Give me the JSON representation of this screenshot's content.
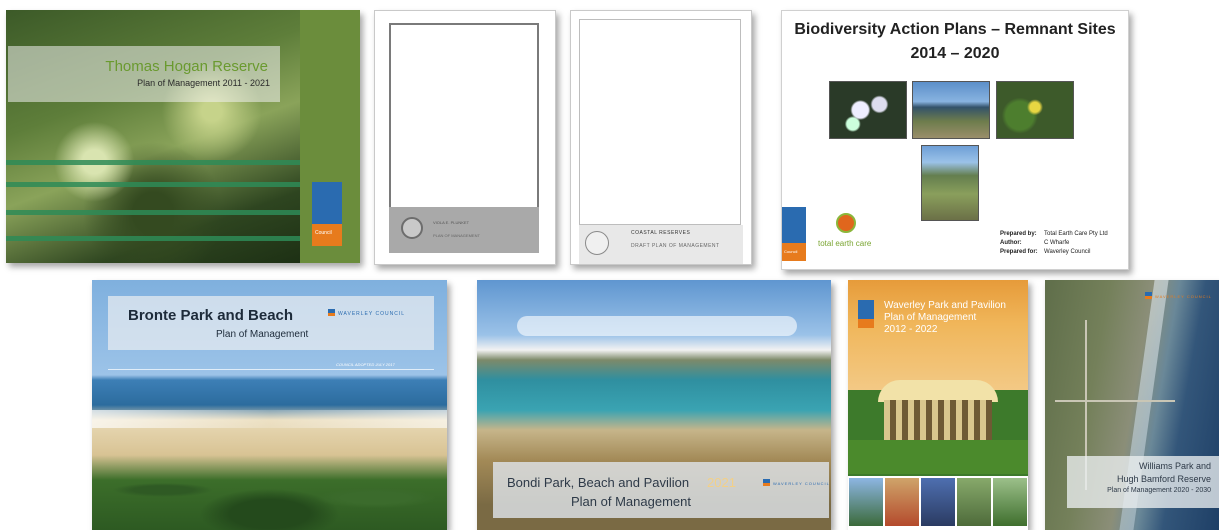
{
  "covers": {
    "thomas_hogan": {
      "title": "Thomas Hogan Reserve",
      "subtitle": "Plan of Management 2011 - 2021",
      "logo_text": "Council"
    },
    "unnamed_cover_1": {
      "line1": "VIOLA E. PLUNKET",
      "line2": "PLAN OF MANAGEMENT"
    },
    "coastal_reserves": {
      "line1": "COASTAL   RESERVES",
      "line2": "DRAFT PLAN OF MANAGEMENT"
    },
    "biodiversity": {
      "title_line1": "Biodiversity Action Plans – Remnant Sites",
      "title_line2": "2014 – 2020",
      "company": "total earth care",
      "logo_text": "Council",
      "prepared_by_label": "Prepared by:",
      "prepared_by_value": "Total Earth Care Pty Ltd",
      "author_label": "Author:",
      "author_value": "C Wharfe",
      "prepared_for_label": "Prepared for:",
      "prepared_for_value": "Waverley Council"
    },
    "bronte": {
      "title": "Bronte Park and Beach",
      "subtitle": "Plan of Management",
      "council": "WAVERLEY COUNCIL",
      "adopted": "COUNCIL ADOPTED JULY 2017"
    },
    "bondi": {
      "title_line1": "Bondi Park, Beach and Pavilion",
      "title_line2": "Plan of Management",
      "year": "2021",
      "council": "WAVERLEY COUNCIL"
    },
    "waverley_park": {
      "title_line1": "Waverley Park and Pavilion",
      "title_line2": "Plan of Management",
      "title_line3": "2012 - 2022"
    },
    "williams_park": {
      "title_line1": "Williams Park and",
      "title_line2": "Hugh Bamford Reserve",
      "title_line3": "Plan of Management 2020 - 2030",
      "council": "WAVERLEY COUNCIL"
    }
  }
}
